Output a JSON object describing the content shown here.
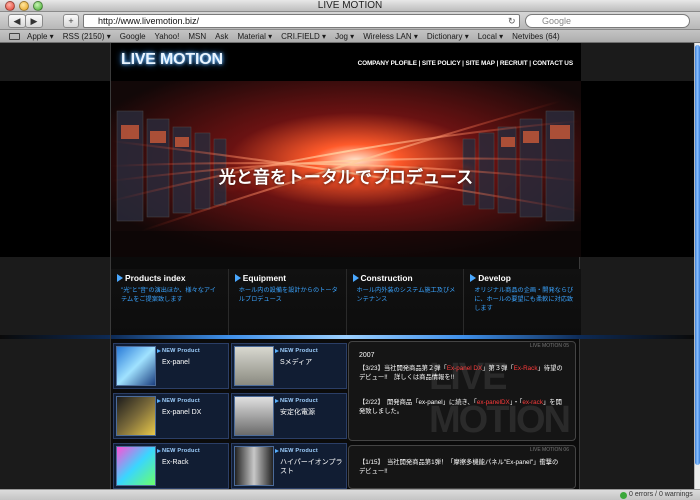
{
  "window": {
    "title": "LIVE MOTION"
  },
  "toolbar": {
    "back": "◀",
    "forward": "▶",
    "reload": "↻",
    "add": "+",
    "url": "http://www.livemotion.biz/",
    "search_placeholder": "Google"
  },
  "bookmarks": [
    "Apple ▾",
    "RSS (2150) ▾",
    "Google",
    "Yahoo!",
    "MSN",
    "Ask",
    "Material ▾",
    "CRI.FIELD ▾",
    "Jog ▾",
    "Wireless LAN ▾",
    "Dictionary ▾",
    "Local ▾",
    "Netvibes (64)"
  ],
  "site": {
    "logo": "LIVE MOTION",
    "nav": "COMPANY PLOFILE | SITE POLICY | SITE MAP | RECRUIT | CONTACT US",
    "hero_text": "光と音をトータルでプロデュース"
  },
  "categories": [
    {
      "title": "Products index",
      "desc": "\"光\"と\"音\"の演出ほか、様々なアイテムをご提案致します"
    },
    {
      "title": "Equipment",
      "desc": "ホール内の設備を設計からのトータルプロデュース"
    },
    {
      "title": "Construction",
      "desc": "ホール内外装のシステム施工及びメンテナンス"
    },
    {
      "title": "Develop",
      "desc": "オリジナル商品の企画・開発ならびに、ホールの要望にも柔軟に対応致します"
    }
  ],
  "products": [
    {
      "badge": "NEW Product",
      "name": "Ex-panel"
    },
    {
      "badge": "NEW Product",
      "name": "Sメディア"
    },
    {
      "badge": "NEW Product",
      "name": "Ex-panel DX"
    },
    {
      "badge": "NEW Product",
      "name": "安定化電源"
    },
    {
      "badge": "NEW Product",
      "name": "Ex-Rack"
    },
    {
      "badge": "NEW Product",
      "name": "ハイパーイオンプラスト"
    }
  ],
  "news": {
    "label": "LIVE MOTION 05",
    "year": "2007",
    "items": [
      {
        "prefix": "【3/23】当社開発商品第２弾「",
        "hl1": "Ex-panel DX",
        "mid": "」第３弾「",
        "hl2": "Ex-Rack",
        "suffix": "」待望のデビュー!!　詳しくは商品情報を!!"
      },
      {
        "prefix": "【2/22】　開発商品「ex-panel」に続き、「",
        "hl1": "ex-panelDX",
        "mid": "」・「",
        "hl2": "ex-rack",
        "suffix": "」を開発致しました。"
      }
    ],
    "label2": "LIVE MOTION 06",
    "items2": [
      "【1/15】　当社開発商品第1弾！「摩擦多機能パネル\"Ex-panel\"」衝撃のデビュー!!"
    ],
    "watermark": "LIVE MOTION"
  },
  "status": {
    "text": "0 errors / 0 warnings"
  },
  "colors": {
    "accent": "#3aa4ff",
    "highlight": "#ff3b3b",
    "logo_glow": "#2f8fff"
  }
}
